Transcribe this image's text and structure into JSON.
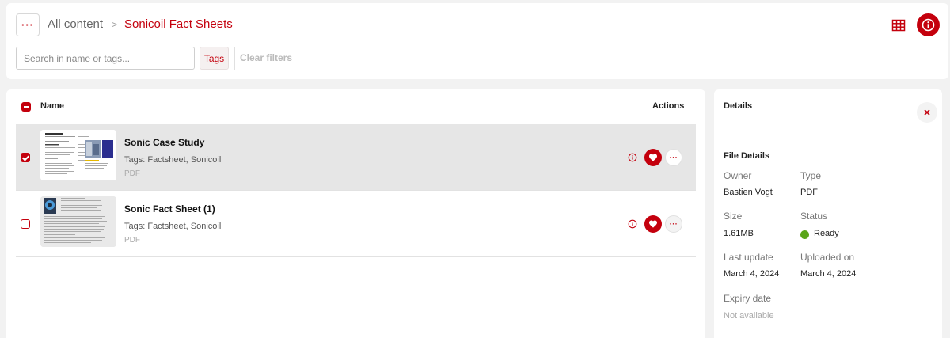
{
  "header": {
    "menu_label": "···",
    "breadcrumb_root": "All content",
    "breadcrumb_separator": ">",
    "breadcrumb_current": "Sonicoil Fact Sheets",
    "search_placeholder": "Search in name or tags...",
    "tags_button": "Tags",
    "clear_filters": "Clear filters"
  },
  "list": {
    "col_name": "Name",
    "col_actions": "Actions",
    "more_label": "···",
    "rows": [
      {
        "title": "Sonic Case Study",
        "tags": "Tags: Factsheet, Sonicoil",
        "type": "PDF",
        "selected": true
      },
      {
        "title": "Sonic Fact Sheet (1)",
        "tags": "Tags: Factsheet, Sonicoil",
        "type": "PDF",
        "selected": false
      }
    ]
  },
  "details": {
    "title": "Details",
    "section": "File Details",
    "owner_label": "Owner",
    "owner": "Bastien Vogt",
    "type_label": "Type",
    "type": "PDF",
    "size_label": "Size",
    "size": "1.61MB",
    "status_label": "Status",
    "status": "Ready",
    "last_update_label": "Last update",
    "last_update": "March 4, 2024",
    "uploaded_label": "Uploaded on",
    "uploaded": "March 4, 2024",
    "expiry_label": "Expiry date",
    "expiry": "Not available"
  },
  "colors": {
    "accent": "#c4000d",
    "status_ready": "#5aa519"
  },
  "icons": [
    "grid-icon",
    "info-icon",
    "heart-icon",
    "close-icon",
    "more-icon"
  ]
}
